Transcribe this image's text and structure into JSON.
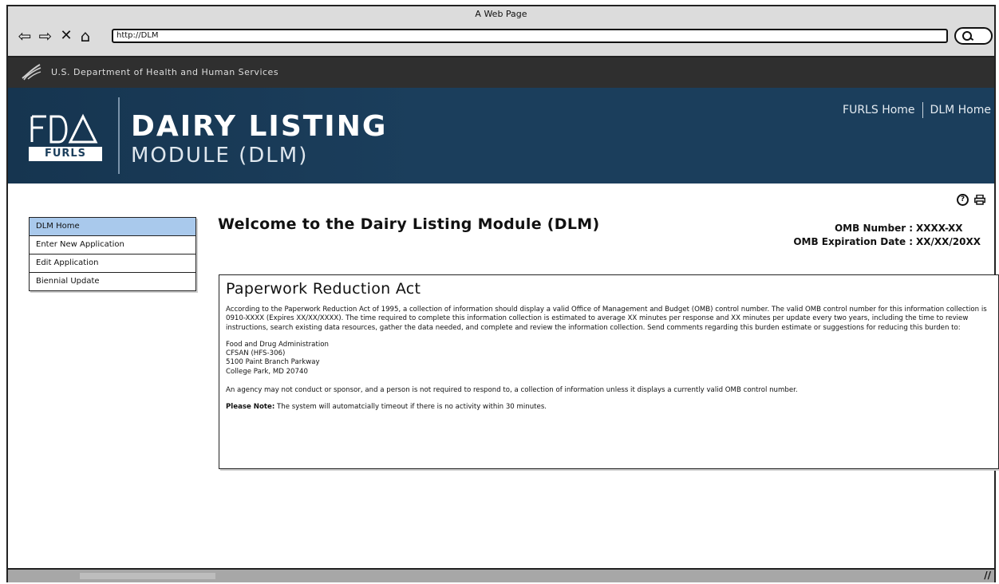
{
  "browser": {
    "window_title": "A Web Page",
    "url": "http://DLM"
  },
  "hhs": {
    "text": "U.S. Department of Health and Human Services"
  },
  "header": {
    "logo_text": "FURLS",
    "title_main": "DAIRY LISTING",
    "title_sub": "MODULE (DLM)",
    "links": [
      "FURLS Home",
      "DLM Home"
    ]
  },
  "sidebar": {
    "items": [
      {
        "label": "DLM Home",
        "active": true
      },
      {
        "label": "Enter New Application",
        "active": false
      },
      {
        "label": "Edit Application",
        "active": false
      },
      {
        "label": "Biennial Update",
        "active": false
      }
    ]
  },
  "main": {
    "welcome": "Welcome to the Dairy Listing Module (DLM)",
    "omb_number_label": "OMB Number",
    "omb_number_value": "XXXX-XX",
    "omb_exp_label": "OMB Expiration Date",
    "omb_exp_value": "XX/XX/20XX"
  },
  "pra": {
    "title": "Paperwork Reduction Act",
    "paragraph1": "According to the Paperwork Reduction Act of 1995, a collection of information should display a valid Office of Management and Budget (OMB) control number. The valid OMB control number for this information collection is 0910-XXXX (Expires XX/XX/XXXX). The time required to complete this information collection is estimated to average XX minutes per response and XX minutes per update every two years, including the time to review instructions, search existing data resources, gather the data needed, and complete and review the information collection. Send comments regarding this burden estimate or suggestions for reducing this burden to:",
    "address": [
      "Food and Drug Administration",
      "CFSAN (HFS-306)",
      "5100 Paint Branch Parkway",
      "College Park, MD 20740"
    ],
    "paragraph2": "An agency may not conduct or sponsor, and a person is not required to respond to, a collection of information unless it displays a currently valid OMB control number.",
    "note_label": "Please Note:",
    "note_text": "The system will automatcially timeout if there is no activity within 30 minutes."
  },
  "icons": {
    "help": "help-icon",
    "print": "print-icon"
  }
}
